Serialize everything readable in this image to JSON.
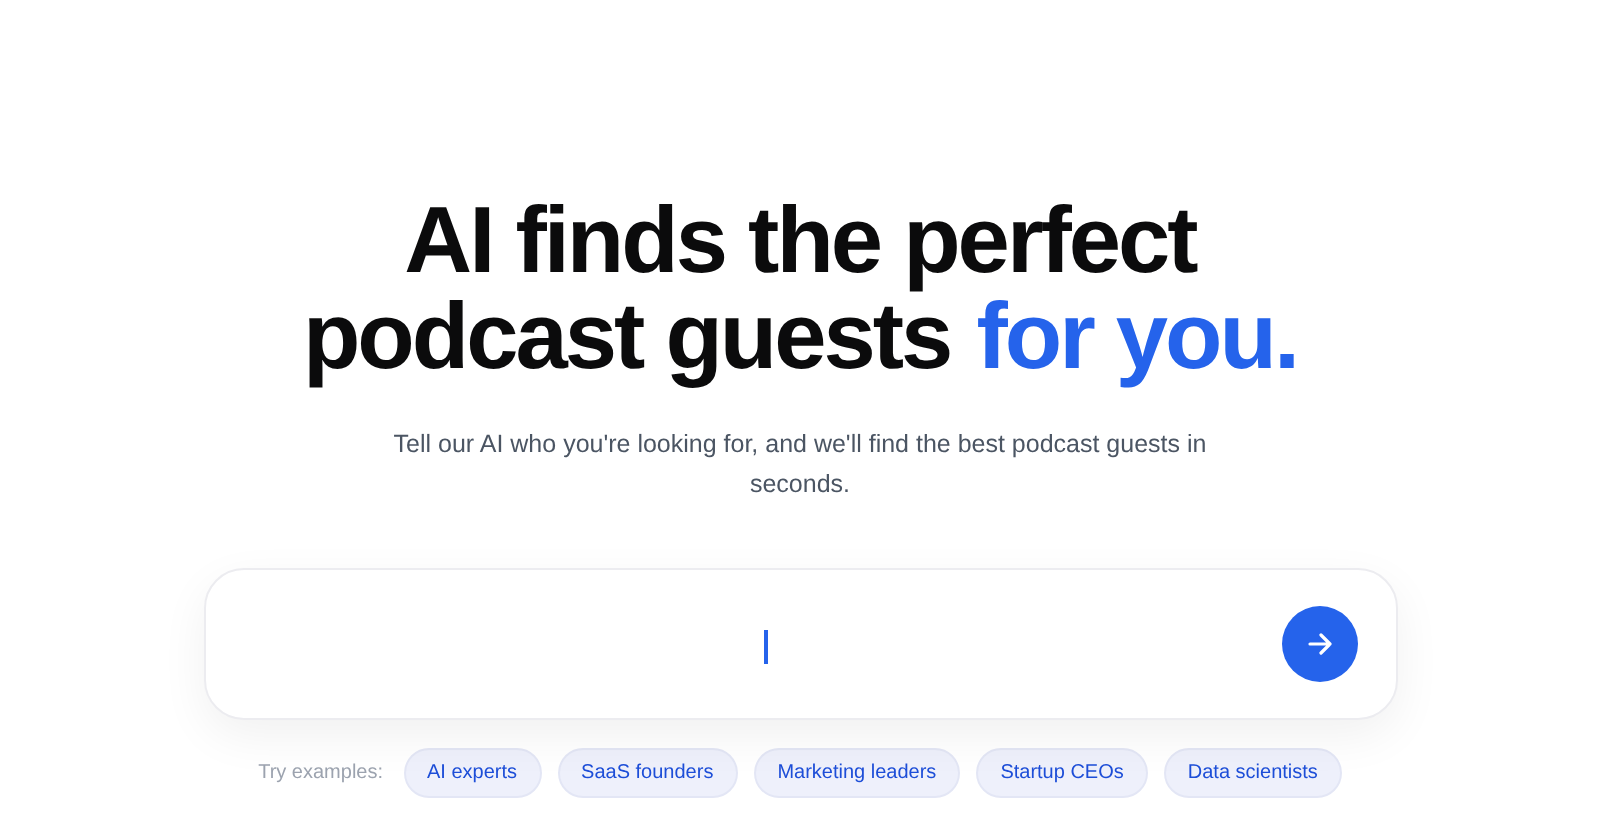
{
  "headline": {
    "line_1": "AI finds the perfect",
    "line_2": "podcast guests",
    "highlight": "for you."
  },
  "subtitle": "Tell our AI who you're looking for, and we'll find the best podcast guests in seconds.",
  "search": {
    "focused": true
  },
  "examples": {
    "label": "Try examples:",
    "chips": [
      "AI experts",
      "SaaS founders",
      "Marketing leaders",
      "Startup CEOs",
      "Data scientists"
    ]
  }
}
